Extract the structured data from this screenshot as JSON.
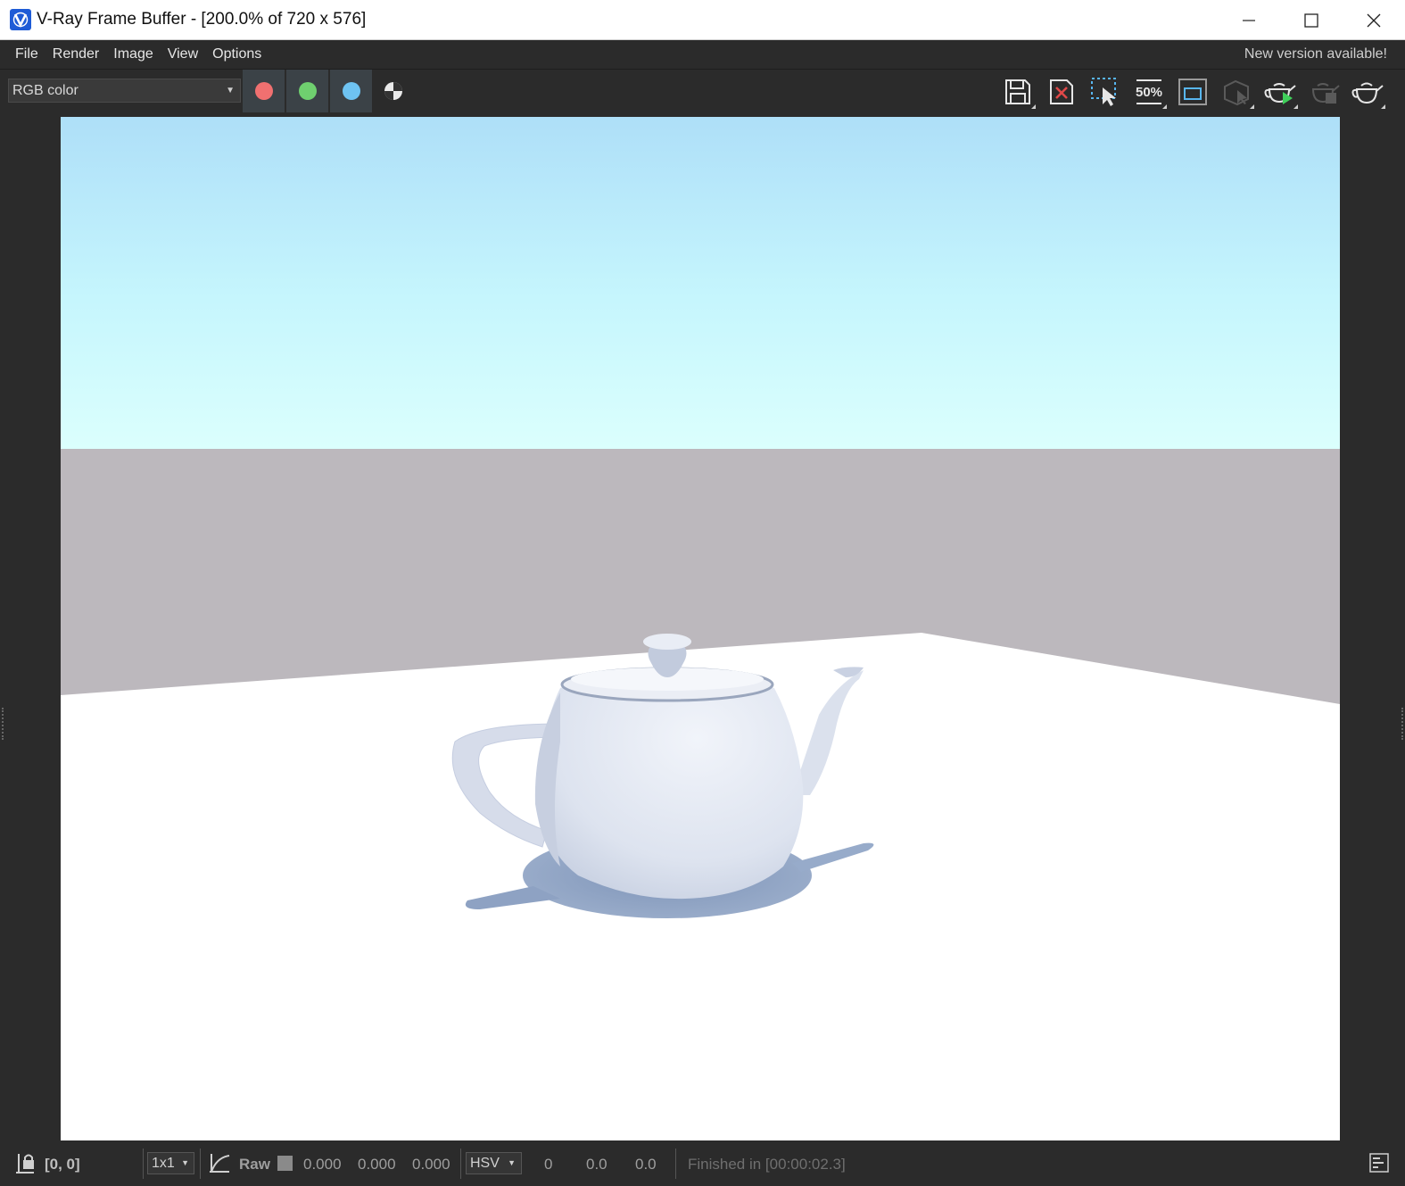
{
  "window": {
    "title": "V-Ray Frame Buffer - [200.0% of 720 x 576]",
    "icon": "vray-logo-icon"
  },
  "menu": {
    "items": [
      "File",
      "Render",
      "Image",
      "View",
      "Options"
    ],
    "notice": "New version available!"
  },
  "toolbar": {
    "channel": "RGB color",
    "channel_buttons": [
      {
        "name": "red-channel-icon",
        "color": "#f07070"
      },
      {
        "name": "green-channel-icon",
        "color": "#6fd06f"
      },
      {
        "name": "blue-channel-icon",
        "color": "#6ec3f2"
      }
    ],
    "tools": [
      {
        "name": "save-image-icon",
        "active": true
      },
      {
        "name": "clear-image-icon",
        "active": true
      },
      {
        "name": "region-render-icon",
        "active": true
      },
      {
        "name": "zoom-50-icon",
        "label": "50%",
        "active": true
      },
      {
        "name": "compare-icon",
        "active": true
      },
      {
        "name": "interactive-render-icon",
        "active": false
      },
      {
        "name": "start-interactive-icon",
        "active": true
      },
      {
        "name": "stop-render-icon",
        "active": false
      },
      {
        "name": "render-teapot-icon",
        "active": true
      }
    ]
  },
  "status": {
    "coords": "[0, 0]",
    "sample_size": "1x1",
    "raw_label": "Raw",
    "raw_values": [
      "0.000",
      "0.000",
      "0.000"
    ],
    "color_mode": "HSV",
    "hsv_values": [
      "0",
      "0.0",
      "0.0"
    ],
    "message": "Finished in [00:00:02.3]"
  },
  "colors": {
    "sky_top": "#aedff8",
    "sky_horizon": "#dbfffd",
    "wall": "#bcb8bd",
    "floor": "#ffffff",
    "teapot": "#dfe4f0",
    "shadow": "#8a9fc0"
  }
}
